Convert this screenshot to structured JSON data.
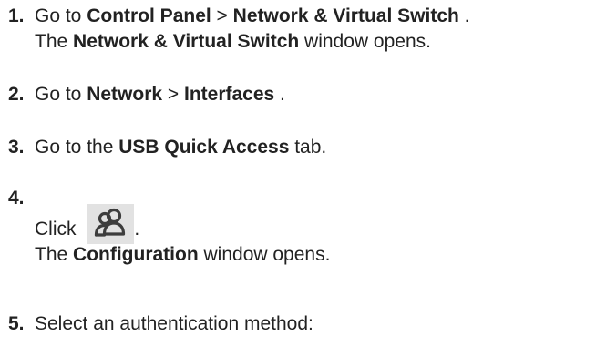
{
  "steps": [
    {
      "number": "1.",
      "line1": {
        "pre": "Go to ",
        "b1": "Control Panel",
        "mid": " > ",
        "b2": "Network & Virtual Switch",
        "post": " ."
      },
      "line2": {
        "pre": "The ",
        "b1": "Network & Virtual Switch",
        "post": " window opens."
      }
    },
    {
      "number": "2.",
      "line1": {
        "pre": "Go to ",
        "b1": "Network",
        "mid": " > ",
        "b2": "Interfaces",
        "post": " ."
      }
    },
    {
      "number": "3.",
      "line1": {
        "pre": "Go to the ",
        "b1": "USB Quick Access",
        "post": " tab."
      }
    },
    {
      "number": "4.",
      "click_text": "Click ",
      "click_after": ".",
      "icon": "users-icon",
      "line2": {
        "pre": "The ",
        "b1": "Configuration",
        "post": " window opens."
      }
    },
    {
      "number": "5.",
      "line1": {
        "text": "Select an authentication method:"
      }
    }
  ]
}
